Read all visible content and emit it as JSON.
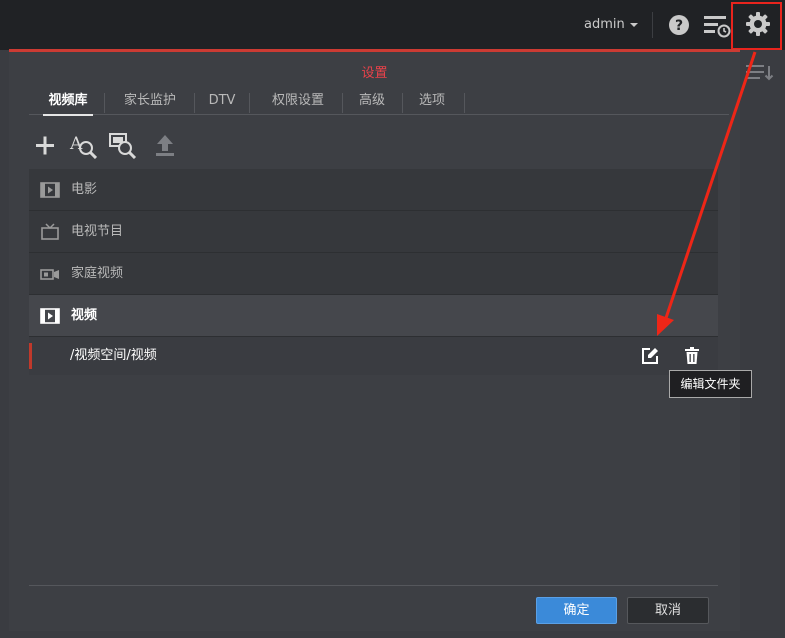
{
  "header": {
    "user": "admin"
  },
  "icons": {
    "help": "help-icon",
    "queue": "activity-queue-icon",
    "settings": "gear-icon",
    "sort": "sort-icon"
  },
  "dialog": {
    "title": "设置",
    "tabs": [
      "视频库",
      "家长监护",
      "DTV",
      "权限设置",
      "高级",
      "选项"
    ],
    "active_tab": "视频库",
    "toolbar": [
      "add-icon",
      "rescan-icon",
      "refresh-metadata-icon",
      "upload-icon"
    ],
    "libraries": [
      {
        "label": "电影",
        "icon": "movie-icon",
        "selected": false
      },
      {
        "label": "电视节目",
        "icon": "tv-icon",
        "selected": false
      },
      {
        "label": "家庭视频",
        "icon": "camera-icon",
        "selected": false
      },
      {
        "label": "视频",
        "icon": "video-icon",
        "selected": true
      }
    ],
    "folder": {
      "path": "/视频空间/视频"
    },
    "tooltip": "编辑文件夹",
    "ok_label": "确定",
    "cancel_label": "取消"
  },
  "colors": {
    "accent_red": "#e8241d",
    "primary_blue": "#3b8ad9",
    "background": "#3a3c41",
    "topbar": "#202225"
  }
}
